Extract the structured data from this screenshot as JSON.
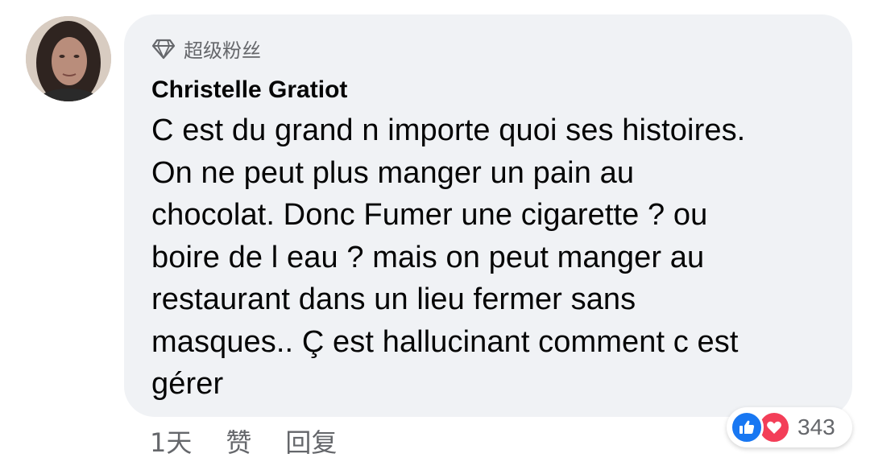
{
  "badge": {
    "icon": "diamond-icon",
    "label": "超级粉丝"
  },
  "author": {
    "name": "Christelle Gratiot"
  },
  "comment": {
    "text": "C est du grand n importe quoi ses histoires.\nOn ne peut plus manger un pain au\nchocolat. Donc  Fumer une cigarette ? ou\nboire de l eau ? mais on peut manger au\nrestaurant dans un lieu fermer sans\nmasques.. Ç est hallucinant comment c est\ngérer"
  },
  "actions": {
    "time": "1天",
    "like_label": "赞",
    "reply_label": "回复"
  },
  "reactions": {
    "icons": [
      "like-icon",
      "love-icon"
    ],
    "count": "343"
  },
  "colors": {
    "bubble": "#f0f2f5",
    "text": "#050505",
    "secondary": "#65676b",
    "like": "#1877f2",
    "love": "#f33e58"
  }
}
